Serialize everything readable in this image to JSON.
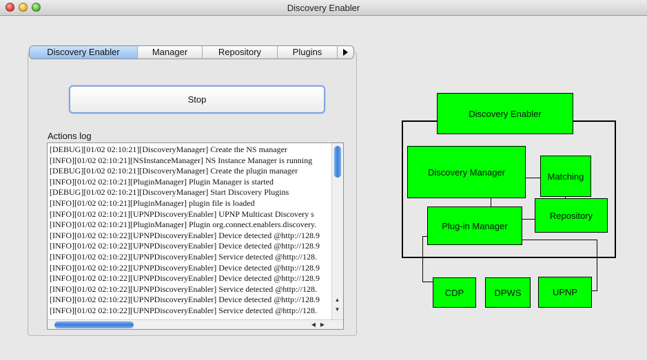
{
  "window": {
    "title": "Discovery Enabler"
  },
  "tabs": [
    {
      "label": "Discovery Enabler",
      "active": true
    },
    {
      "label": "Manager",
      "active": false
    },
    {
      "label": "Repository",
      "active": false
    },
    {
      "label": "Plugins",
      "active": false
    }
  ],
  "tab_overflow_icon": "triangle-right-icon",
  "controls": {
    "stop_label": "Stop"
  },
  "log": {
    "label": "Actions log",
    "lines": [
      "[DEBUG][01/02 02:10:21][DiscoveryManager] Create the NS manager",
      "[INFO][01/02 02:10:21][NSInstanceManager] NS Instance Manager is running",
      "[DEBUG][01/02 02:10:21][DiscoveryManager] Create the plugin manager",
      "[INFO][01/02 02:10:21][PluginManager] Plugin Manager is started",
      "[DEBUG][01/02 02:10:21][DiscoveryManager] Start Discovery Plugins",
      "[INFO][01/02 02:10:21][PluginManager] plugin file is loaded",
      "[INFO][01/02 02:10:21][UPNPDiscoveryEnabler] UPNP Multicast Discovery s",
      "[INFO][01/02 02:10:21][PluginManager] Plugin org.connect.enablers.discovery.",
      "[INFO][01/02 02:10:22][UPNPDiscoveryEnabler] Device detected @http://128.9",
      "[INFO][01/02 02:10:22][UPNPDiscoveryEnabler] Device detected @http://128.9",
      "[INFO][01/02 02:10:22][UPNPDiscoveryEnabler] Service detected @http://128.",
      "[INFO][01/02 02:10:22][UPNPDiscoveryEnabler] Device detected @http://128.9",
      "[INFO][01/02 02:10:22][UPNPDiscoveryEnabler] Device detected @http://128.9",
      "[INFO][01/02 02:10:22][UPNPDiscoveryEnabler] Service detected @http://128.",
      "[INFO][01/02 02:10:22][UPNPDiscoveryEnabler] Device detected @http://128.9",
      "[INFO][01/02 02:10:22][UPNPDiscoveryEnabler] Service detected @http://128."
    ]
  },
  "diagram": {
    "color": "#00ff00",
    "boxes": {
      "discovery_enabler": "Discovery Enabler",
      "discovery_manager": "Discovery Manager",
      "matching": "Matching",
      "repository": "Repository",
      "plugin_manager": "Plug-in Manager",
      "cdp": "CDP",
      "dpws": "DPWS",
      "upnp": "UPNP"
    }
  }
}
